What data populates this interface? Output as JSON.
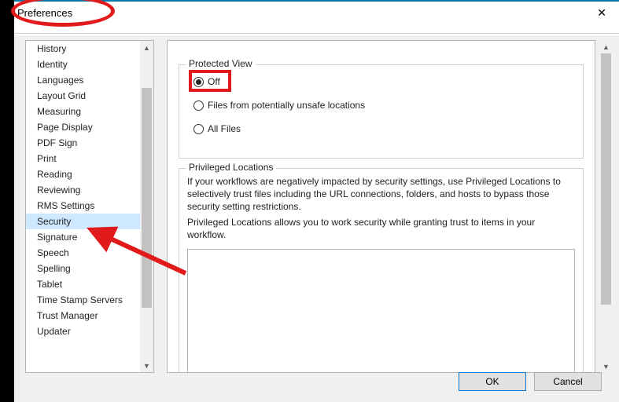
{
  "window": {
    "title": "Preferences",
    "close_glyph": "✕"
  },
  "sidebar": {
    "items": [
      {
        "label": "History",
        "selected": false
      },
      {
        "label": "Identity",
        "selected": false
      },
      {
        "label": "Languages",
        "selected": false
      },
      {
        "label": "Layout Grid",
        "selected": false
      },
      {
        "label": "Measuring",
        "selected": false
      },
      {
        "label": "Page Display",
        "selected": false
      },
      {
        "label": "PDF Sign",
        "selected": false
      },
      {
        "label": "Print",
        "selected": false
      },
      {
        "label": "Reading",
        "selected": false
      },
      {
        "label": "Reviewing",
        "selected": false
      },
      {
        "label": "RMS Settings",
        "selected": false
      },
      {
        "label": "Security",
        "selected": true
      },
      {
        "label": "Signature",
        "selected": false
      },
      {
        "label": "Speech",
        "selected": false
      },
      {
        "label": "Spelling",
        "selected": false
      },
      {
        "label": "Tablet",
        "selected": false
      },
      {
        "label": "Time Stamp Servers",
        "selected": false
      },
      {
        "label": "Trust Manager",
        "selected": false
      },
      {
        "label": "Updater",
        "selected": false
      }
    ],
    "scroll_up": "▲",
    "scroll_down": "▼"
  },
  "main": {
    "protected_view": {
      "legend": "Protected View",
      "options": [
        {
          "label": "Off",
          "checked": true
        },
        {
          "label": "Files from potentially unsafe locations",
          "checked": false
        },
        {
          "label": "All Files",
          "checked": false
        }
      ]
    },
    "privileged_locations": {
      "legend": "Privileged Locations",
      "desc1": "If your workflows are negatively impacted by security settings, use Privileged Locations to selectively trust files including the URL connections, folders, and hosts to bypass those security setting restrictions.",
      "desc2": "Privileged Locations allows you to work security while granting trust to items in your workflow."
    }
  },
  "footer": {
    "ok": "OK",
    "cancel": "Cancel"
  },
  "annotations": {
    "title_circle": true,
    "off_rect": true,
    "arrow_to_security": true
  }
}
